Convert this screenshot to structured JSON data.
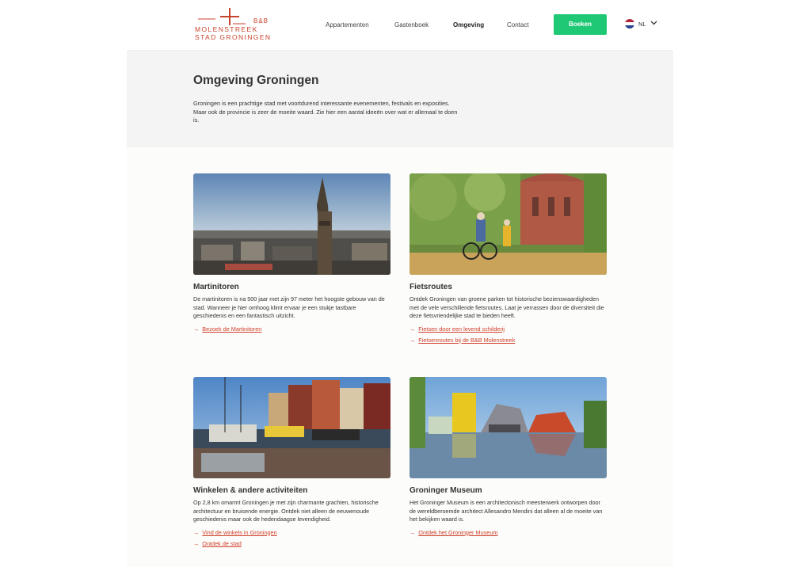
{
  "header": {
    "logo": {
      "bnb": "B&B",
      "line1": "MOLENSTREEK",
      "line2": "STAD GRONINGEN"
    },
    "nav": [
      {
        "label": "Appartementen",
        "active": false
      },
      {
        "label": "Gastenboek",
        "active": false
      },
      {
        "label": "Omgeving",
        "active": true
      },
      {
        "label": "Contact",
        "active": false
      }
    ],
    "book_label": "Boeken",
    "language": "NL"
  },
  "intro": {
    "title": "Omgeving Groningen",
    "text": "Groningen is een prachtige stad met voortdurend interessante evenementen, festivals en exposities. Maar ook de provincie is zeer de moeite waard. Zie hier een aantal ideeën over wat er allemaal te doen is."
  },
  "cards": [
    {
      "title": "Martinitoren",
      "text": "De martinitoren is na 500 jaar met zijn 97 meter het hoogste gebouw van de stad. Wanneer je hier omhoog klimt ervaar je een stukje tastbare geschiedenis en een fantastisch uitzicht.",
      "links": [
        "Bezoek de Martinitoren"
      ]
    },
    {
      "title": "Fietsroutes",
      "text": "Ontdek Groningen van groene parken tot historische bezienswaardigheden met de vele verschillende fietsroutes. Laat je verrassen door de diversiteit die deze fietsvriendelijke stad te bieden heeft.",
      "links": [
        "Fietsen door een levend schilderij",
        "Fietsenroutes bij de B&B Molenstreek"
      ]
    },
    {
      "title": "Winkelen & andere activiteiten",
      "text": "Op 2,8 km omarmt Groningen je met zijn charmante grachten, historische architectuur en bruisende energie. Ontdek niet alleen de eeuwenoude geschiedenis maar ook de hedendaagse levendigheid.",
      "links": [
        "Vind de winkels in Groningen",
        "Ontdek de stad"
      ]
    },
    {
      "title": "Groninger Museum",
      "text": "Het Groninger Museum is een architectonisch meesterwerk ontworpen door de wereldberoemde architect Allesandro Mendini dat alleen al de moeite van het bekijken waard is.",
      "links": [
        "Ontdek het Groninger Museum"
      ]
    }
  ],
  "colors": {
    "accent": "#1fc874",
    "brand": "#c8432b",
    "link": "#d0402a"
  }
}
